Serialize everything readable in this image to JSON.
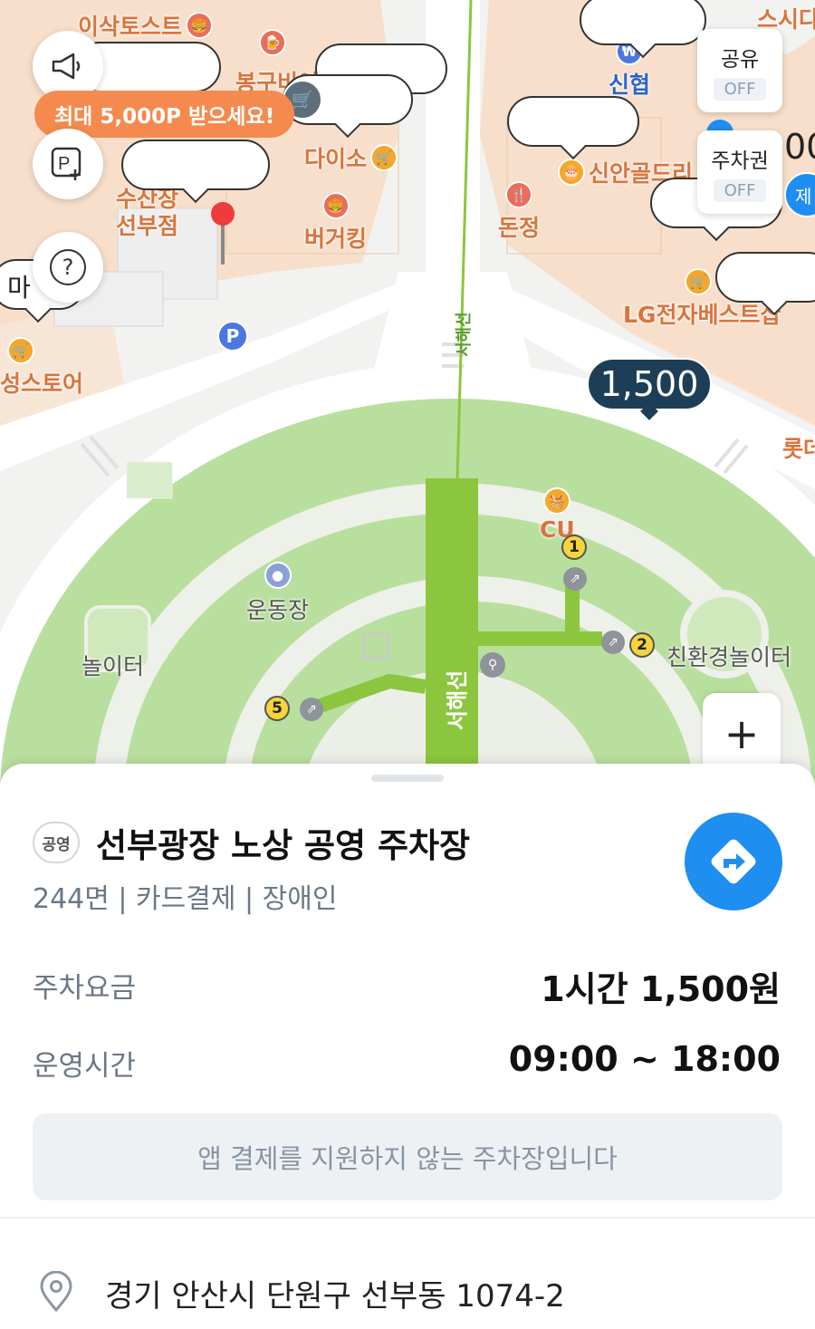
{
  "map": {
    "pois": [
      {
        "label": "이삭토스트"
      },
      {
        "label": "봉구비어"
      },
      {
        "label": "다이소"
      },
      {
        "label": "버거킹"
      },
      {
        "label": "수산장\n선부점"
      },
      {
        "label": "신협"
      },
      {
        "label": "신안골드리"
      },
      {
        "label": "돈정"
      },
      {
        "label": "LG전자베스트샵"
      },
      {
        "label": "스시다"
      },
      {
        "label": "롯데"
      },
      {
        "label": "성스토어"
      },
      {
        "label": "마"
      },
      {
        "label": "CU"
      },
      {
        "label": "운동장"
      },
      {
        "label": "놀이터"
      },
      {
        "label": "친환경놀이터"
      }
    ],
    "subway_line": {
      "name": "서해선"
    },
    "price_marker": "1,500",
    "partial_marker": "00",
    "partial_marker2": "제",
    "parking_icon": "P",
    "promo_text": "최대 5,000P 받으세요!",
    "gates": [
      "1",
      "2",
      "5"
    ],
    "toggles": [
      {
        "label": "공유",
        "state": "OFF"
      },
      {
        "label": "주차권",
        "state": "OFF"
      }
    ],
    "help_icon": "?",
    "zoom_in": "+"
  },
  "lot": {
    "type_badge": "공영",
    "name": "선부광장 노상 공영 주차장",
    "meta": "244면 | 카드결제 | 장애인",
    "fee_label": "주차요금",
    "fee_value": "1시간 1,500원",
    "hours_label": "운영시간",
    "hours_value": "09:00 ~ 18:00",
    "notice": "앱 결제를 지원하지 않는 주차장입니다",
    "address": "경기 안산시 단원구 선부동 1074-2"
  },
  "colors": {
    "accent_blue": "#1e8ef0",
    "promo_orange": "#f58a4e",
    "price_marker": "#1d3e57",
    "park_green": "#b9df9e",
    "subway_green": "#8cc63f"
  }
}
